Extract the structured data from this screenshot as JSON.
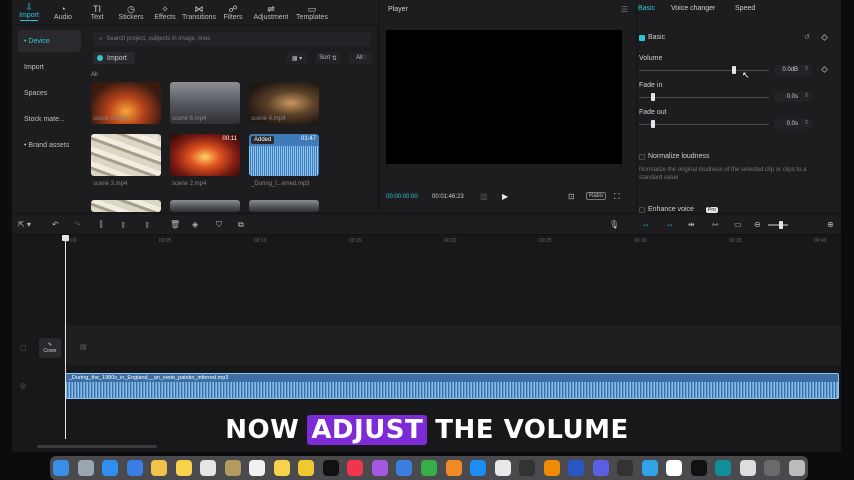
{
  "toolbar": {
    "items": [
      {
        "label": "Import",
        "icon": "import-icon",
        "active": true
      },
      {
        "label": "Audio",
        "icon": "audio-icon"
      },
      {
        "label": "Text",
        "icon": "text-icon"
      },
      {
        "label": "Stickers",
        "icon": "stickers-icon"
      },
      {
        "label": "Effects",
        "icon": "effects-icon"
      },
      {
        "label": "Transitions",
        "icon": "transitions-icon"
      },
      {
        "label": "Filters",
        "icon": "filters-icon"
      },
      {
        "label": "Adjustment",
        "icon": "adjustment-icon"
      },
      {
        "label": "Templates",
        "icon": "templates-icon"
      }
    ]
  },
  "sidebar": {
    "items": [
      {
        "label": "• Device",
        "active": true
      },
      {
        "label": "Import"
      },
      {
        "label": "Spaces"
      },
      {
        "label": "Stock mate..."
      },
      {
        "label": "• Brand assets"
      }
    ]
  },
  "media": {
    "search_placeholder": "Search project, subjects in image, lines",
    "import_label": "Import",
    "sort_label": "Sort",
    "all_button": "All",
    "all_label": "All",
    "items": [
      {
        "name": "scene 5.mp4",
        "duration": "",
        "badge": ""
      },
      {
        "name": "scene 6.mp4",
        "duration": "",
        "badge": ""
      },
      {
        "name": "scene 4.mp4",
        "duration": "",
        "badge": ""
      },
      {
        "name": "scene 3.mp4",
        "duration": "00:08",
        "badge": ""
      },
      {
        "name": "scene 2.mp4",
        "duration": "00:11",
        "badge": ""
      },
      {
        "name": "_During_t...erred.mp3",
        "duration": "01:47",
        "badge": "Added"
      }
    ]
  },
  "player": {
    "title": "Player",
    "current_time": "00:00:00:00",
    "total_time": "00:01:46:23",
    "ratio_label": "Ratio"
  },
  "inspector": {
    "tabs": [
      {
        "label": "Basic",
        "active": true
      },
      {
        "label": "Voice changer"
      },
      {
        "label": "Speed"
      }
    ],
    "section_title": "Basic",
    "volume_label": "Volume",
    "volume_value": "0.0dB",
    "volume_level": 0.73,
    "fade_in_label": "Fade in",
    "fade_in_value": "0.0s",
    "fade_out_label": "Fade out",
    "fade_out_value": "0.0s",
    "normalize_label": "Normalize loudness",
    "normalize_desc": "Normalize the original loudness of the selected clip or clips to a standard value",
    "enhance_label": "Enhance voice",
    "pro_badge": "Pro"
  },
  "timeline": {
    "ticks": [
      "00:00",
      "00:05",
      "00:10",
      "00:15",
      "00:20",
      "00:25",
      "00:30",
      "00:35",
      "00:40"
    ],
    "cover_label": "Cover",
    "audio_clip_name": "_During_the_1980s_in_England__an_eerie_paintin_inferred.mp3"
  },
  "caption": {
    "before": "NOW",
    "highlight": "ADJUST",
    "after": "THE VOLUME",
    "highlight_color": "#7d2bd6"
  },
  "accent_color": "#2fc6d6",
  "dock": {
    "icons": [
      "finder-icon",
      "launchpad-icon",
      "safari-icon",
      "mail-icon",
      "photos-icon",
      "notes-icon",
      "calendar-icon",
      "files-icon",
      "reminders-icon",
      "notes2-icon",
      "stickies-icon",
      "appletv-icon",
      "music-icon",
      "podcasts-icon",
      "keynote-icon",
      "numbers-icon",
      "pages-icon",
      "appstore-icon",
      "chrome-icon",
      "terminal-icon",
      "vlc-icon",
      "shield-icon",
      "app-icon",
      "obs-icon",
      "skype-icon",
      "notion-icon",
      "capcut-icon",
      "capcut2-icon",
      "preview-icon",
      "screen-icon",
      "trash-icon"
    ],
    "colors": [
      "#3b8fe8",
      "#9aa6b2",
      "#2f8ff0",
      "#3c7de6",
      "#f2c24a",
      "#f6d34a",
      "#e6e6e6",
      "#b39a5e",
      "#f1f1f1",
      "#f7d24b",
      "#f0c830",
      "#111111",
      "#f0364d",
      "#a458e0",
      "#3b7fe0",
      "#35b04a",
      "#f08a24",
      "#1c8ef2",
      "#e8e8e8",
      "#333333",
      "#f08a00",
      "#2a57c6",
      "#5a5fe6",
      "#333333",
      "#2fa3e6",
      "#ffffff",
      "#111111",
      "#0e8f9a",
      "#dddddd",
      "#6a6a6a",
      "#bbbbbb"
    ]
  }
}
